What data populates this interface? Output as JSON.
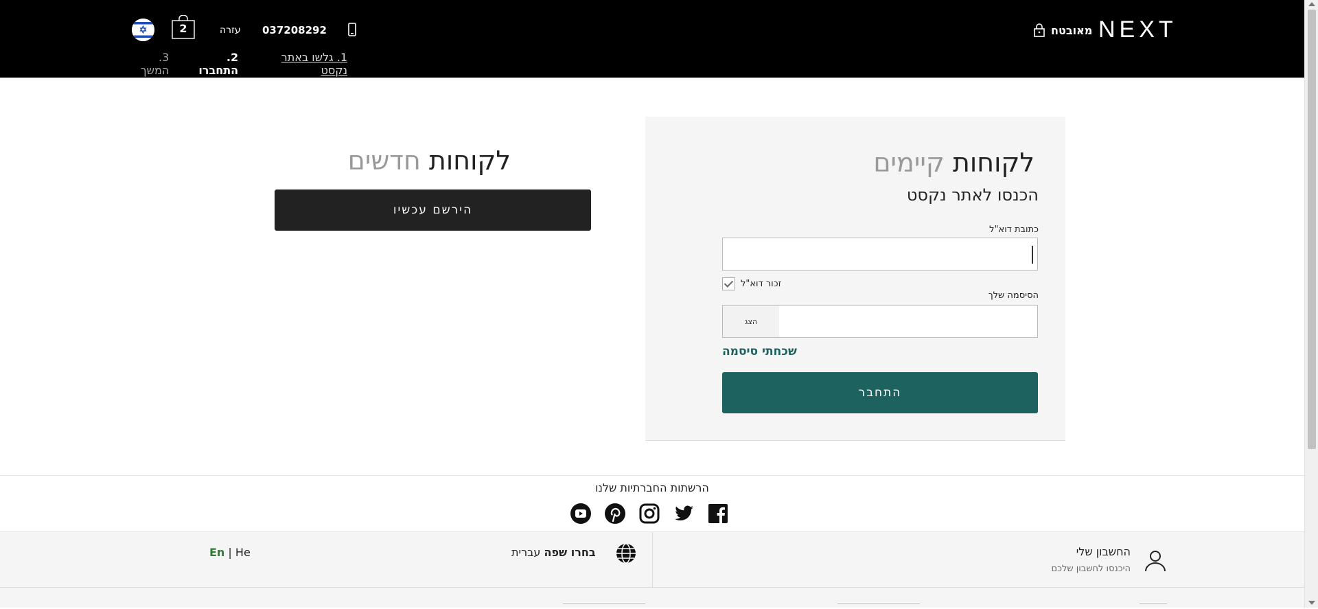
{
  "header": {
    "logo": "NEXT",
    "secure_label": "מאובטח",
    "phone": "037208292",
    "help": "עזרה",
    "bag_count": "2",
    "steps": {
      "step1": "1. גלשו באתר נקסט",
      "step2": "2. התחברו",
      "step3": "3. המשך"
    }
  },
  "existing": {
    "title_dark": "לקוחות",
    "title_light": "קיימים",
    "subtitle": "הכנסו לאתר נקסט",
    "email_label": "כתובת דוא\"ל",
    "email_value": "",
    "remember_label": "זכור דוא\"ל",
    "remember_checked": true,
    "password_label": "הסיסמה שלך",
    "show_label": "הצג",
    "forgot_label": "שכחתי סיסמה",
    "login_label": "התחבר"
  },
  "new_customers": {
    "title_dark": "לקוחות",
    "title_light": "חדשים",
    "register_label": "הירשם עכשיו"
  },
  "social": {
    "title": "הרשתות החברתיות שלנו",
    "icons": [
      "youtube-icon",
      "pinterest-icon",
      "instagram-icon",
      "twitter-icon",
      "facebook-icon"
    ]
  },
  "footer": {
    "account_title": "החשבון שלי",
    "account_sub": "היכנסו לחשבון שלכם",
    "lang_choose": "בחרו שפה",
    "lang_current": "עברית",
    "lang_en": "En",
    "lang_sep": "|",
    "lang_he": "He"
  },
  "colors": {
    "header_bg": "#000000",
    "accent_teal": "#1d625e",
    "dark_button": "#222222",
    "panel_bg": "#f5f5f5"
  }
}
